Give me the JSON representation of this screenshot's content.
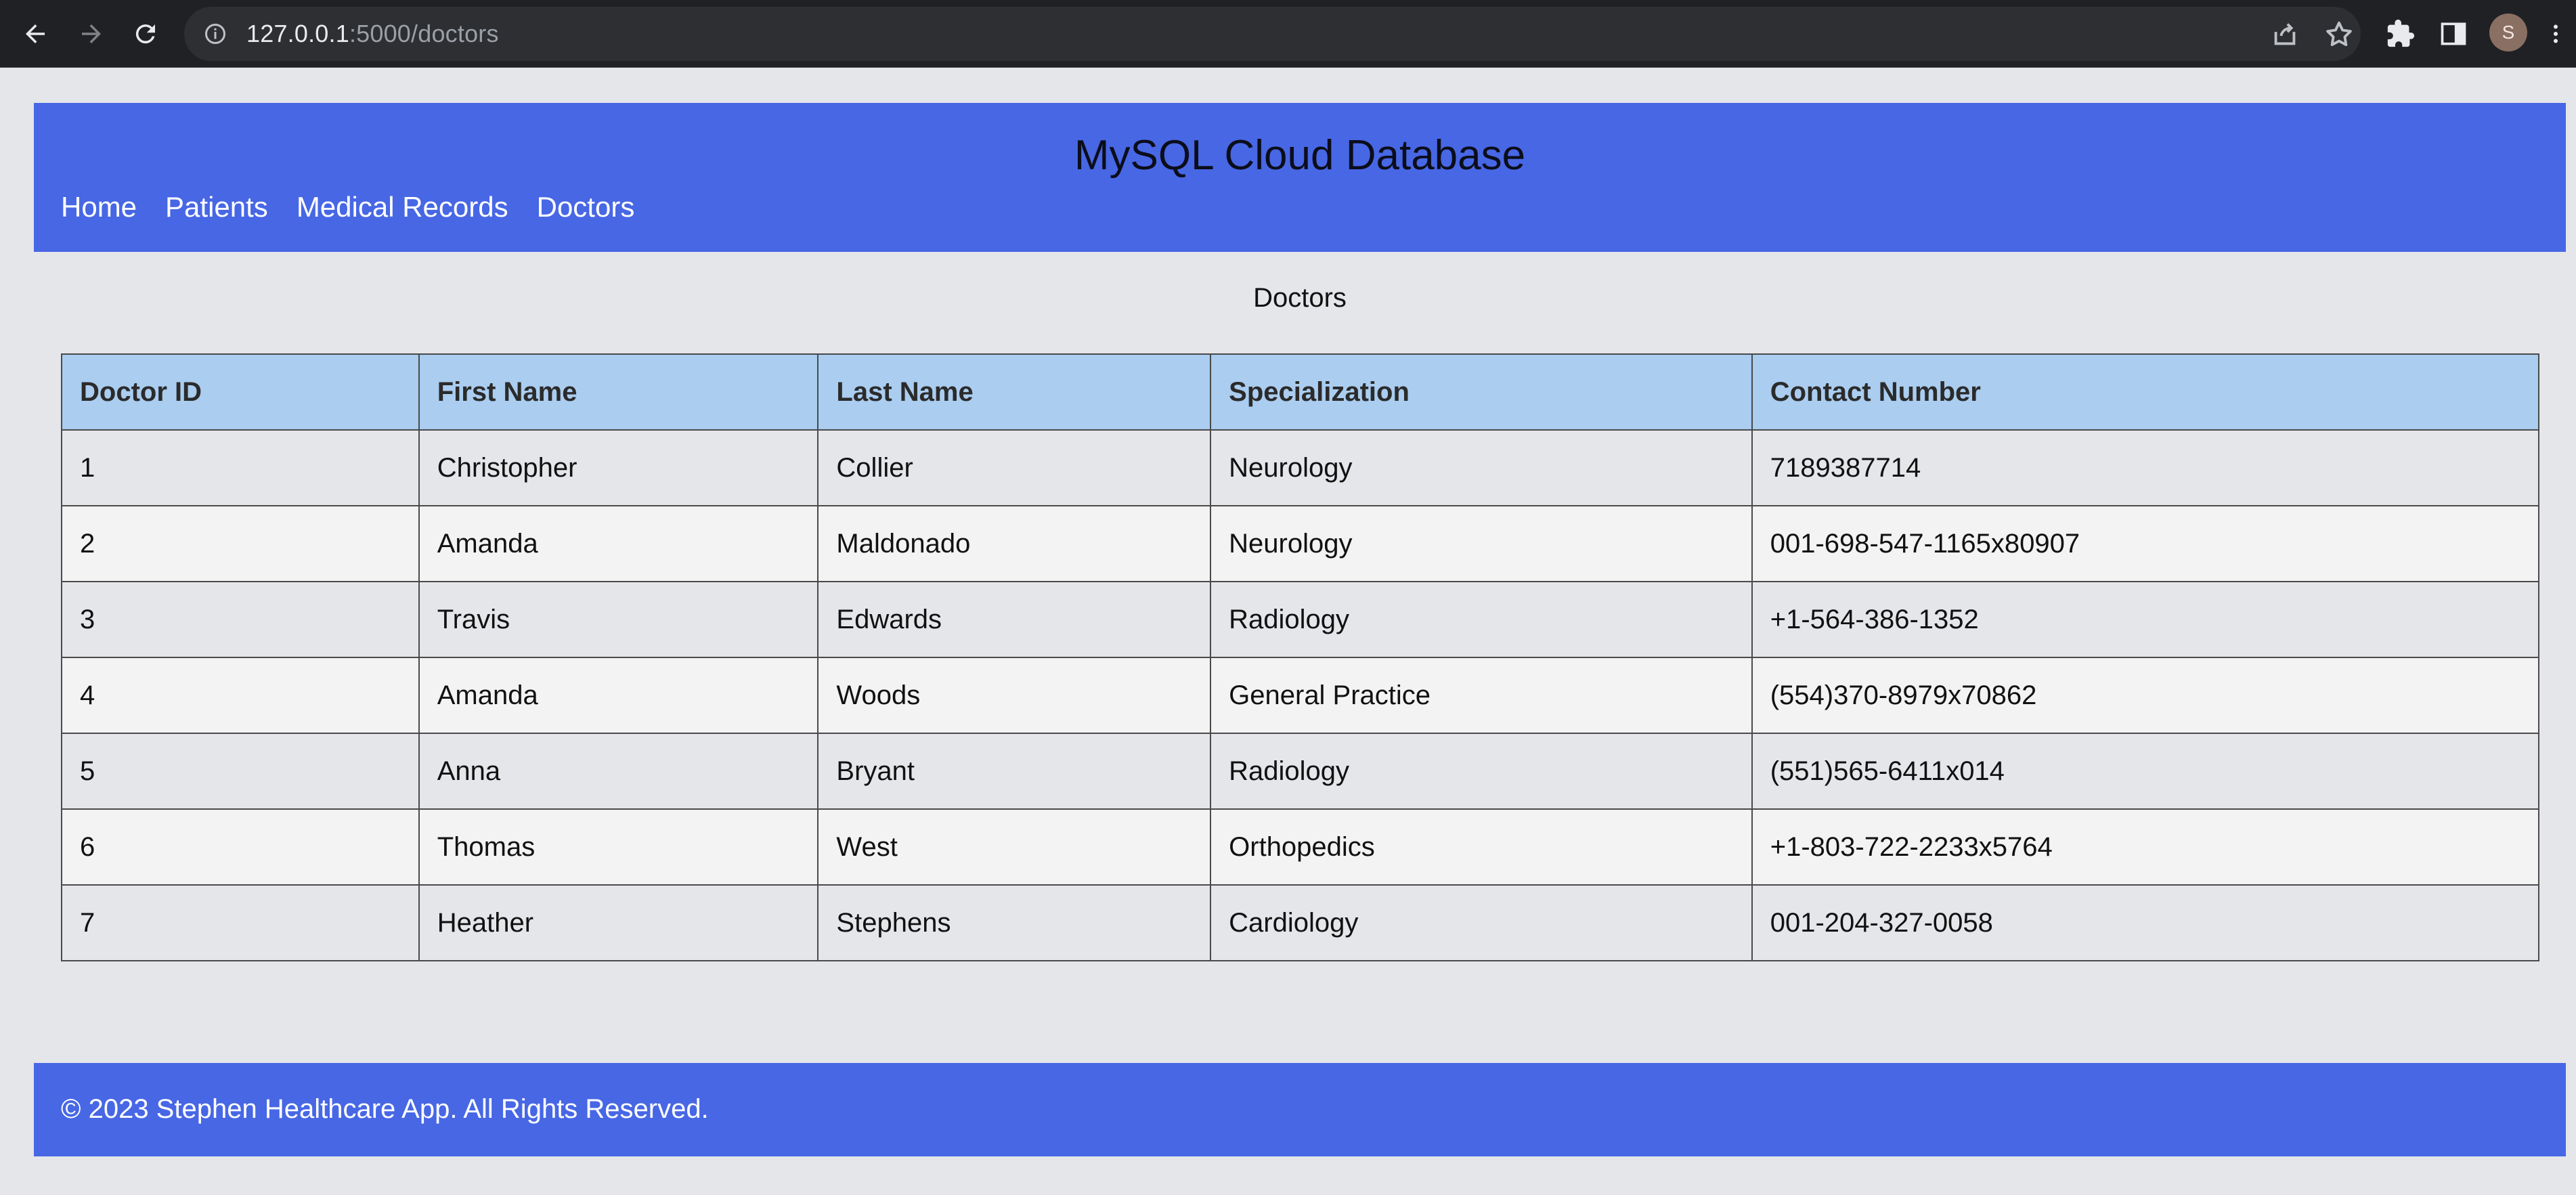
{
  "browser": {
    "url_host": "127.0.0.1",
    "url_path": ":5000/doctors",
    "avatar_letter": "S"
  },
  "header": {
    "title": "MySQL Cloud Database",
    "nav": [
      "Home",
      "Patients",
      "Medical Records",
      "Doctors"
    ]
  },
  "section_title": "Doctors",
  "table": {
    "columns": [
      "Doctor ID",
      "First Name",
      "Last Name",
      "Specialization",
      "Contact Number"
    ],
    "rows": [
      [
        "1",
        "Christopher",
        "Collier",
        "Neurology",
        "7189387714"
      ],
      [
        "2",
        "Amanda",
        "Maldonado",
        "Neurology",
        "001-698-547-1165x80907"
      ],
      [
        "3",
        "Travis",
        "Edwards",
        "Radiology",
        "+1-564-386-1352"
      ],
      [
        "4",
        "Amanda",
        "Woods",
        "General Practice",
        "(554)370-8979x70862"
      ],
      [
        "5",
        "Anna",
        "Bryant",
        "Radiology",
        "(551)565-6411x014"
      ],
      [
        "6",
        "Thomas",
        "West",
        "Orthopedics",
        "+1-803-722-2233x5764"
      ],
      [
        "7",
        "Heather",
        "Stephens",
        "Cardiology",
        "001-204-327-0058"
      ]
    ]
  },
  "footer": {
    "text": "© 2023 Stephen Healthcare App. All Rights Reserved."
  },
  "colors": {
    "header_bg": "#4767e5",
    "table_header_bg": "#aacdf0",
    "page_bg": "#e5e6ea"
  }
}
